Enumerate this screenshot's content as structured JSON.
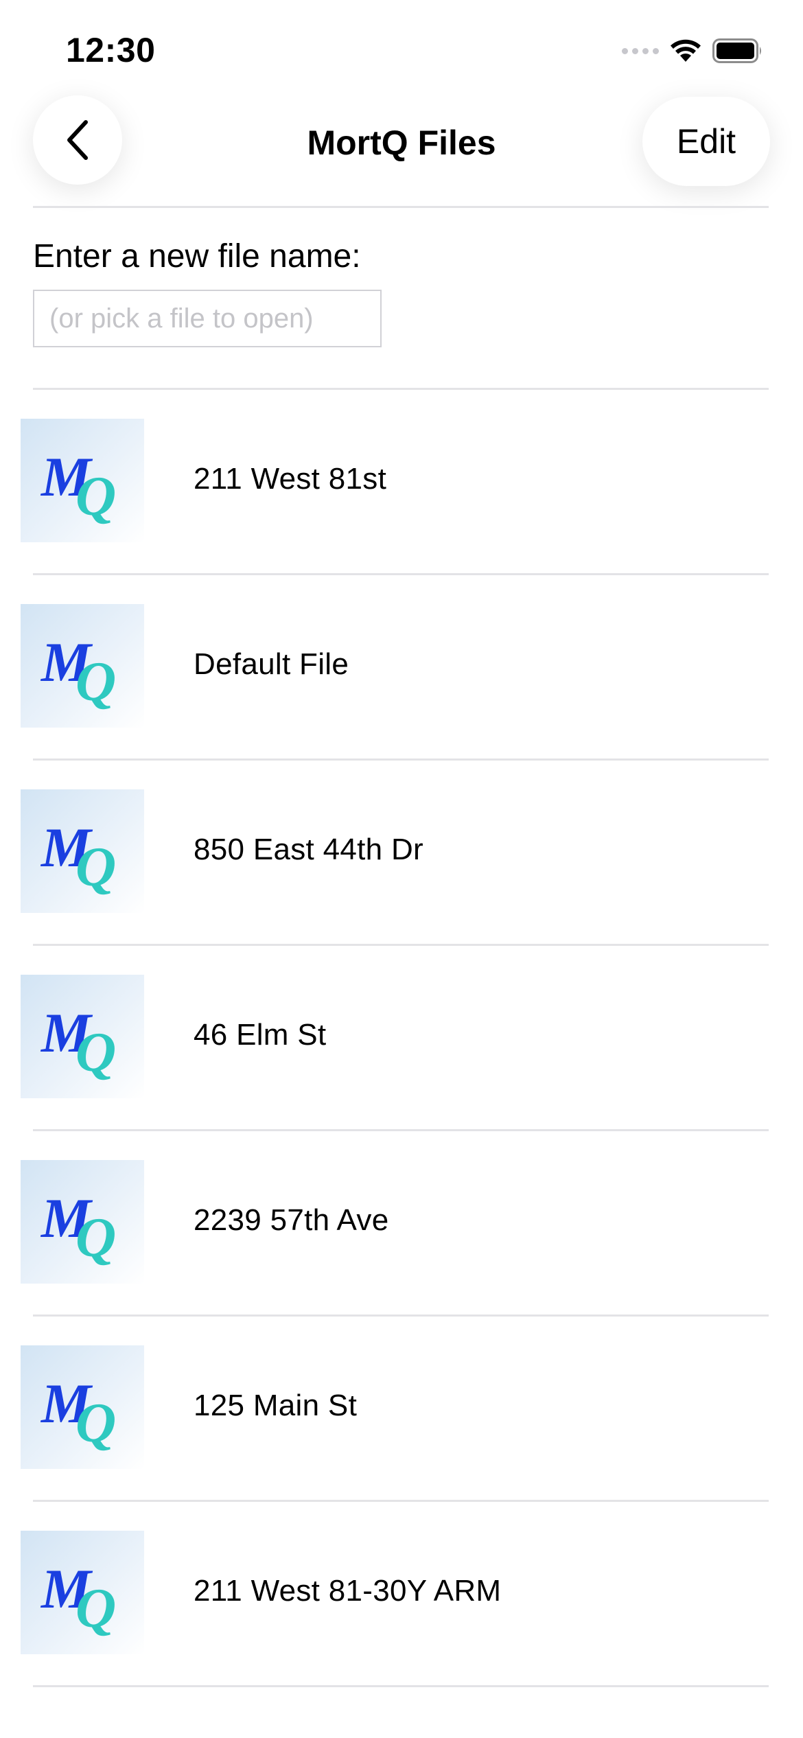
{
  "status_bar": {
    "time": "12:30",
    "icons": [
      "cellular-signal-icon",
      "wifi-icon",
      "battery-icon"
    ]
  },
  "nav": {
    "back_icon": "chevron-left-icon",
    "title": "MortQ Files",
    "edit_label": "Edit"
  },
  "new_file": {
    "label": "Enter a new file name:",
    "value": "",
    "placeholder": "(or pick a file to open)"
  },
  "files": [
    {
      "name": "211 West 81st"
    },
    {
      "name": "Default File"
    },
    {
      "name": "850 East 44th Dr"
    },
    {
      "name": "46 Elm St"
    },
    {
      "name": "2239 57th Ave"
    },
    {
      "name": "125 Main St"
    },
    {
      "name": "211 West 81-30Y ARM"
    }
  ],
  "logo": {
    "letter_m": "M",
    "letter_q": "Q",
    "color_m": "#1a3fe0",
    "color_q": "#2ec9c0"
  }
}
